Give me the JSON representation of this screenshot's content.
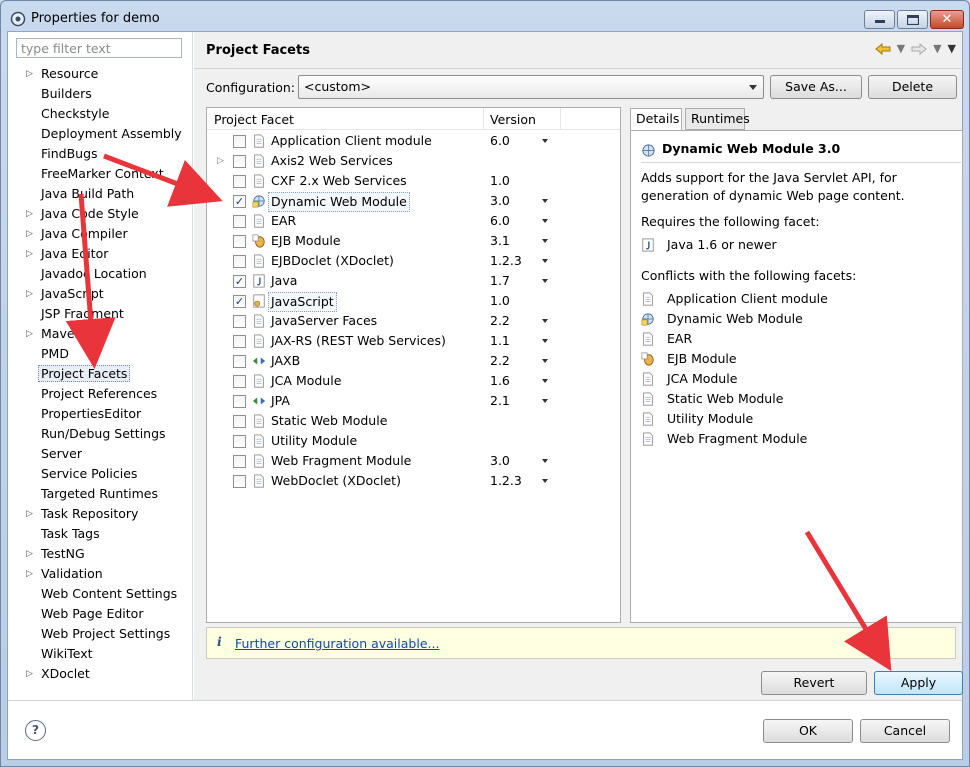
{
  "window": {
    "title": "Properties for demo"
  },
  "filter": {
    "placeholder": "type filter text"
  },
  "tree": [
    {
      "label": "Resource",
      "expandable": true
    },
    {
      "label": "Builders",
      "expandable": false
    },
    {
      "label": "Checkstyle",
      "expandable": false
    },
    {
      "label": "Deployment Assembly",
      "expandable": false
    },
    {
      "label": "FindBugs",
      "expandable": false
    },
    {
      "label": "FreeMarker Context",
      "expandable": false
    },
    {
      "label": "Java Build Path",
      "expandable": false
    },
    {
      "label": "Java Code Style",
      "expandable": true
    },
    {
      "label": "Java Compiler",
      "expandable": true
    },
    {
      "label": "Java Editor",
      "expandable": true
    },
    {
      "label": "Javadoc Location",
      "expandable": false
    },
    {
      "label": "JavaScript",
      "expandable": true
    },
    {
      "label": "JSP Fragment",
      "expandable": false
    },
    {
      "label": "Maven",
      "expandable": true
    },
    {
      "label": "PMD",
      "expandable": false
    },
    {
      "label": "Project Facets",
      "expandable": false,
      "selected": true
    },
    {
      "label": "Project References",
      "expandable": false
    },
    {
      "label": "PropertiesEditor",
      "expandable": false
    },
    {
      "label": "Run/Debug Settings",
      "expandable": false
    },
    {
      "label": "Server",
      "expandable": false
    },
    {
      "label": "Service Policies",
      "expandable": false
    },
    {
      "label": "Targeted Runtimes",
      "expandable": false
    },
    {
      "label": "Task Repository",
      "expandable": true
    },
    {
      "label": "Task Tags",
      "expandable": false
    },
    {
      "label": "TestNG",
      "expandable": true
    },
    {
      "label": "Validation",
      "expandable": true
    },
    {
      "label": "Web Content Settings",
      "expandable": false
    },
    {
      "label": "Web Page Editor",
      "expandable": false
    },
    {
      "label": "Web Project Settings",
      "expandable": false
    },
    {
      "label": "WikiText",
      "expandable": false
    },
    {
      "label": "XDoclet",
      "expandable": true
    }
  ],
  "page": {
    "title": "Project Facets"
  },
  "configuration": {
    "label": "Configuration:",
    "value": "<custom>",
    "save_as": "Save As...",
    "delete": "Delete"
  },
  "facet_table": {
    "col_facet": "Project Facet",
    "col_version": "Version",
    "rows": [
      {
        "name": "Application Client module",
        "version": "6.0",
        "checked": false,
        "dropdown": true,
        "expandable": false,
        "icon": "page"
      },
      {
        "name": "Axis2 Web Services",
        "version": "",
        "checked": false,
        "dropdown": false,
        "expandable": true,
        "icon": "page"
      },
      {
        "name": "CXF 2.x Web Services",
        "version": "1.0",
        "checked": false,
        "dropdown": false,
        "expandable": false,
        "icon": "page"
      },
      {
        "name": "Dynamic Web Module",
        "version": "3.0",
        "checked": true,
        "dropdown": true,
        "expandable": false,
        "icon": "globe",
        "selected": true
      },
      {
        "name": "EAR",
        "version": "6.0",
        "checked": false,
        "dropdown": true,
        "expandable": false,
        "icon": "page"
      },
      {
        "name": "EJB Module",
        "version": "3.1",
        "checked": false,
        "dropdown": true,
        "expandable": false,
        "icon": "bean"
      },
      {
        "name": "EJBDoclet (XDoclet)",
        "version": "1.2.3",
        "checked": false,
        "dropdown": true,
        "expandable": false,
        "icon": "page"
      },
      {
        "name": "Java",
        "version": "1.7",
        "checked": true,
        "dropdown": true,
        "expandable": false,
        "icon": "java"
      },
      {
        "name": "JavaScript",
        "version": "1.0",
        "checked": true,
        "dropdown": false,
        "expandable": false,
        "icon": "js",
        "boxed": true
      },
      {
        "name": "JavaServer Faces",
        "version": "2.2",
        "checked": false,
        "dropdown": true,
        "expandable": false,
        "icon": "page"
      },
      {
        "name": "JAX-RS (REST Web Services)",
        "version": "1.1",
        "checked": false,
        "dropdown": true,
        "expandable": false,
        "icon": "page"
      },
      {
        "name": "JAXB",
        "version": "2.2",
        "checked": false,
        "dropdown": true,
        "expandable": false,
        "icon": "arrows"
      },
      {
        "name": "JCA Module",
        "version": "1.6",
        "checked": false,
        "dropdown": true,
        "expandable": false,
        "icon": "page"
      },
      {
        "name": "JPA",
        "version": "2.1",
        "checked": false,
        "dropdown": true,
        "expandable": false,
        "icon": "arrows"
      },
      {
        "name": "Static Web Module",
        "version": "",
        "checked": false,
        "dropdown": false,
        "expandable": false,
        "icon": "page"
      },
      {
        "name": "Utility Module",
        "version": "",
        "checked": false,
        "dropdown": false,
        "expandable": false,
        "icon": "page"
      },
      {
        "name": "Web Fragment Module",
        "version": "3.0",
        "checked": false,
        "dropdown": true,
        "expandable": false,
        "icon": "page"
      },
      {
        "name": "WebDoclet (XDoclet)",
        "version": "1.2.3",
        "checked": false,
        "dropdown": true,
        "expandable": false,
        "icon": "page"
      }
    ]
  },
  "details_tabs": {
    "details": "Details",
    "runtimes": "Runtimes"
  },
  "details": {
    "title": "Dynamic Web Module 3.0",
    "description": "Adds support for the Java Servlet API, for generation of dynamic Web page content.",
    "requires_label": "Requires the following facet:",
    "requires": [
      {
        "name": "Java 1.6 or newer",
        "icon": "java"
      }
    ],
    "conflicts_label": "Conflicts with the following facets:",
    "conflicts": [
      {
        "name": "Application Client module",
        "icon": "page"
      },
      {
        "name": "Dynamic Web Module",
        "icon": "globe"
      },
      {
        "name": "EAR",
        "icon": "page"
      },
      {
        "name": "EJB Module",
        "icon": "bean"
      },
      {
        "name": "JCA Module",
        "icon": "page"
      },
      {
        "name": "Static Web Module",
        "icon": "page"
      },
      {
        "name": "Utility Module",
        "icon": "page"
      },
      {
        "name": "Web Fragment Module",
        "icon": "page"
      }
    ]
  },
  "info": {
    "icon_text": "i",
    "link": "Further configuration available..."
  },
  "buttons": {
    "revert": "Revert",
    "apply": "Apply",
    "ok": "OK",
    "cancel": "Cancel",
    "help": "?"
  },
  "colors": {
    "annotation_arrow": "#e8343a",
    "selection_border": "#3c7fb1"
  }
}
